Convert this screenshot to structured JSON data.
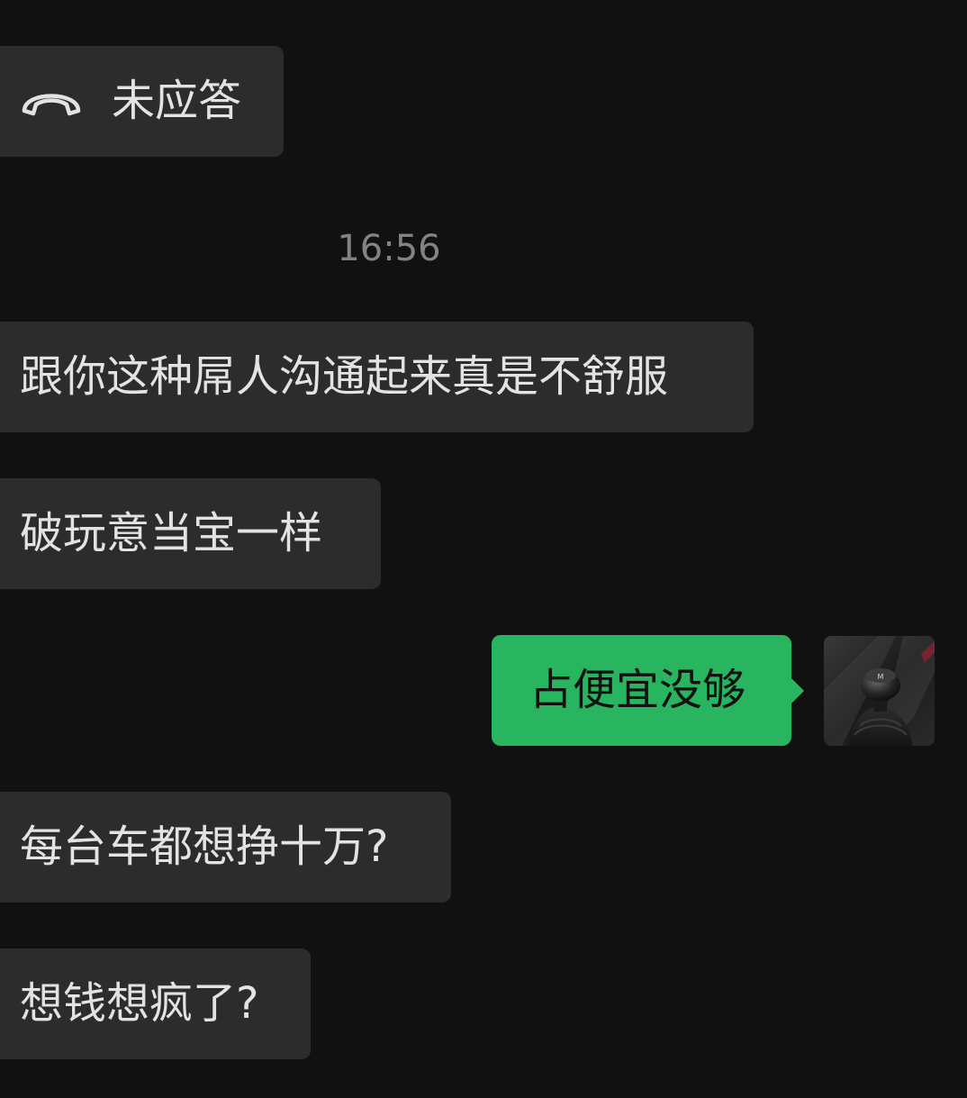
{
  "chat": {
    "missed_call_label": "未应答",
    "timestamp": "16:56",
    "messages": [
      {
        "side": "left",
        "text": "跟你这种屌人沟通起来真是不舒服"
      },
      {
        "side": "left",
        "text": "破玩意当宝一样"
      },
      {
        "side": "right",
        "text": "占便宜没够"
      },
      {
        "side": "left",
        "text": "每台车都想挣十万?"
      },
      {
        "side": "left",
        "text": "想钱想疯了?"
      }
    ]
  },
  "icons": {
    "missed_call": "phone-hangup-icon",
    "avatar": "gear-shifter-avatar"
  },
  "colors": {
    "background": "#111111",
    "incoming_bubble": "#2c2c2c",
    "outgoing_bubble": "#29b560",
    "incoming_text": "#e3e3e3",
    "outgoing_text": "#111111",
    "timestamp_text": "#838383"
  }
}
